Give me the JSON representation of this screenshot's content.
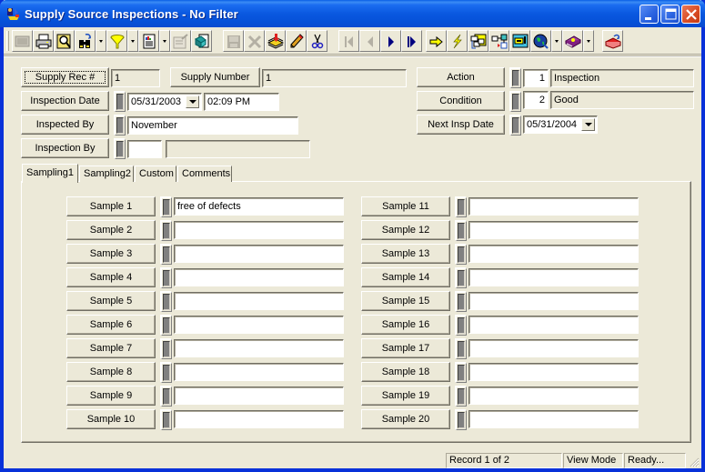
{
  "window": {
    "title": "Supply Source Inspections - No Filter",
    "controls": [
      "minimize",
      "maximize",
      "close"
    ]
  },
  "toolbar": {
    "buttons": [
      {
        "name": "new-record-button",
        "icon": "new-record-icon",
        "enabled": false
      },
      {
        "name": "print-button",
        "icon": "printer-icon",
        "enabled": true
      },
      {
        "name": "print-preview-button",
        "icon": "preview-icon",
        "enabled": true
      },
      {
        "name": "find-button",
        "icon": "binoculars-icon",
        "enabled": true,
        "dropdown": true
      },
      {
        "name": "filter-button",
        "icon": "funnel-icon",
        "enabled": true,
        "dropdown": true
      },
      {
        "name": "report-button",
        "icon": "report-icon",
        "enabled": true,
        "dropdown": true
      },
      {
        "name": "edit-form-button",
        "icon": "form-edit-icon",
        "enabled": false
      },
      {
        "name": "copy-record-button",
        "icon": "copy-record-icon",
        "enabled": true
      },
      {
        "name": "save-button",
        "icon": "disk-icon",
        "enabled": false
      },
      {
        "name": "cancel-button",
        "icon": "x-icon",
        "enabled": false
      },
      {
        "name": "import-button",
        "icon": "stack-icon",
        "enabled": true
      },
      {
        "name": "edit-button",
        "icon": "pencil-icon",
        "enabled": true
      },
      {
        "name": "cut-button",
        "icon": "scissors-icon",
        "enabled": true
      },
      {
        "name": "first-record-button",
        "icon": "first-icon",
        "enabled": false
      },
      {
        "name": "previous-record-button",
        "icon": "previous-icon",
        "enabled": false
      },
      {
        "name": "next-record-button",
        "icon": "next-icon",
        "enabled": true
      },
      {
        "name": "last-record-button",
        "icon": "last-icon",
        "enabled": true
      },
      {
        "name": "goto-button",
        "icon": "arrow-right-icon",
        "enabled": true
      },
      {
        "name": "action-button",
        "icon": "lightning-icon",
        "enabled": true
      },
      {
        "name": "relations-button",
        "icon": "tree-icon",
        "enabled": true
      },
      {
        "name": "workflow-button",
        "icon": "flowchart-icon",
        "enabled": true
      },
      {
        "name": "screen-button",
        "icon": "monitor-icon",
        "enabled": true
      },
      {
        "name": "web-button",
        "icon": "globe-icon",
        "enabled": true,
        "dropdown": true
      },
      {
        "name": "help-button",
        "icon": "book-icon",
        "enabled": true,
        "dropdown": true
      },
      {
        "name": "exit-button",
        "icon": "exit-icon",
        "enabled": true
      }
    ]
  },
  "header": {
    "supply_rec_label": "Supply Rec #",
    "supply_rec_value": "1",
    "supply_number_label": "Supply Number",
    "supply_number_value": "1",
    "inspection_date_label": "Inspection Date",
    "inspection_date_value": "05/31/2003",
    "inspection_time_value": "02:09 PM",
    "inspected_by_label": "Inspected By",
    "inspected_by_value": "November",
    "inspection_by_label": "Inspection By",
    "inspection_by_code": "",
    "inspection_by_desc": "",
    "action_label": "Action",
    "action_code": "1",
    "action_desc": "Inspection",
    "condition_label": "Condition",
    "condition_code": "2",
    "condition_desc": "Good",
    "next_insp_date_label": "Next Insp Date",
    "next_insp_date_value": "05/31/2004"
  },
  "tabs": [
    {
      "label": "Sampling1",
      "active": true
    },
    {
      "label": "Sampling2",
      "active": false
    },
    {
      "label": "Custom",
      "active": false
    },
    {
      "label": "Comments",
      "active": false
    }
  ],
  "samples": [
    {
      "label": "Sample 1",
      "value": "free of defects"
    },
    {
      "label": "Sample 2",
      "value": ""
    },
    {
      "label": "Sample 3",
      "value": ""
    },
    {
      "label": "Sample 4",
      "value": ""
    },
    {
      "label": "Sample 5",
      "value": ""
    },
    {
      "label": "Sample 6",
      "value": ""
    },
    {
      "label": "Sample 7",
      "value": ""
    },
    {
      "label": "Sample 8",
      "value": ""
    },
    {
      "label": "Sample 9",
      "value": ""
    },
    {
      "label": "Sample 10",
      "value": ""
    },
    {
      "label": "Sample 11",
      "value": ""
    },
    {
      "label": "Sample 12",
      "value": ""
    },
    {
      "label": "Sample 13",
      "value": ""
    },
    {
      "label": "Sample 14",
      "value": ""
    },
    {
      "label": "Sample 15",
      "value": ""
    },
    {
      "label": "Sample 16",
      "value": ""
    },
    {
      "label": "Sample 17",
      "value": ""
    },
    {
      "label": "Sample 18",
      "value": ""
    },
    {
      "label": "Sample 19",
      "value": ""
    },
    {
      "label": "Sample 20",
      "value": ""
    }
  ],
  "status": {
    "record": "Record 1 of 2",
    "mode": "View Mode",
    "state": "Ready..."
  },
  "colors": {
    "titlebar": "#0a58e0",
    "face": "#ece9d8",
    "nav_arrow": "#000080"
  }
}
